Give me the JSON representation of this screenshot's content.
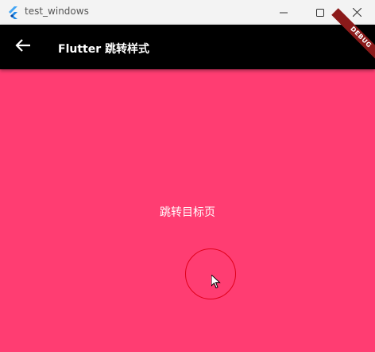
{
  "window": {
    "title": "test_windows",
    "minimize_icon": "minimize-icon",
    "maximize_icon": "maximize-icon",
    "close_icon": "close-icon"
  },
  "appbar": {
    "title": "Flutter 跳转样式",
    "back_icon": "arrow-left-icon",
    "background": "#000000"
  },
  "debug_banner": {
    "label": "DEBUG",
    "color": "#8b1a1a"
  },
  "body": {
    "message": "跳转目标页",
    "background": "#ff3d72"
  }
}
